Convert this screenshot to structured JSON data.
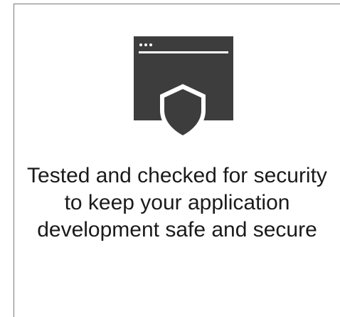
{
  "feature_card": {
    "icon": "browser-window-shield-icon",
    "icon_color": "#3d3d3d",
    "caption_lines": [
      "Tested and checked for security",
      "to keep your application",
      "development safe and secure"
    ]
  }
}
